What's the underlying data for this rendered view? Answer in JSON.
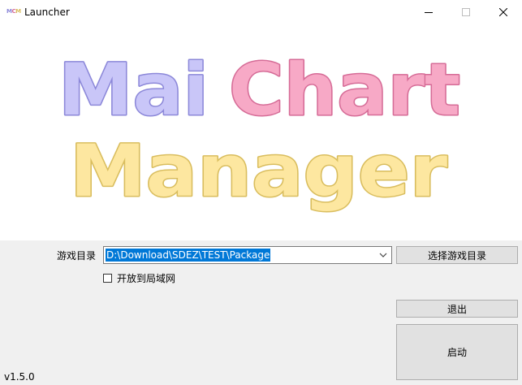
{
  "window": {
    "title": "Launcher",
    "icon_text": [
      "M",
      "C",
      "M"
    ],
    "icon_colors": [
      "#c9c6f8",
      "#f7a9c6",
      "#fde7a0"
    ]
  },
  "banner": {
    "line1_words": [
      "Mai",
      "Chart"
    ],
    "line2_words": [
      "Manager"
    ],
    "colors": {
      "mai_fill": "#c9c6f8",
      "mai_stroke": "#8c88d9",
      "chart_fill": "#f7a9c6",
      "chart_stroke": "#d66c97",
      "manager_fill": "#fde7a0",
      "manager_stroke": "#d9bd5e"
    }
  },
  "form": {
    "dir_label": "游戏目录",
    "dir_value": "D:\\Download\\SDEZ\\TEST\\Package",
    "choose_button": "选择游戏目录",
    "lan_checkbox_label": "开放到局域网",
    "lan_checked": false
  },
  "actions": {
    "exit_button": "退出",
    "start_button": "启动"
  },
  "footer": {
    "version": "v1.5.0"
  }
}
